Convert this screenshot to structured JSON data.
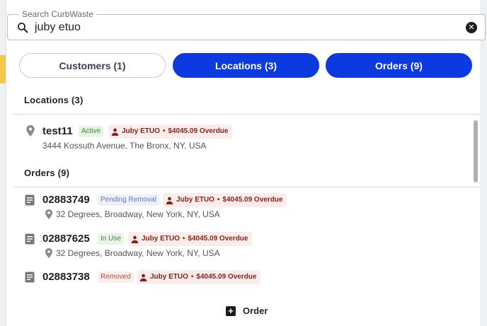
{
  "search": {
    "legend": "Search CurbWaste",
    "value": "juby etuo",
    "placeholder": "Search CurbWaste"
  },
  "tabs": [
    {
      "label": "Customers (1)"
    },
    {
      "label": "Locations (3)"
    },
    {
      "label": "Orders (9)"
    }
  ],
  "locations": {
    "title": "Locations (3)",
    "items": [
      {
        "name": "test11",
        "status": "Active",
        "owner": "Juby ETUO",
        "balance": "$4045.09 Overdue",
        "address": "3444 Kossuth Avenue, The Bronx, NY, USA"
      }
    ]
  },
  "orders": {
    "title": "Orders (9)",
    "items": [
      {
        "number": "02883749",
        "status": "Pending Removal",
        "owner": "Juby ETUO",
        "balance": "$4045.09 Overdue",
        "address": "32 Degrees, Broadway, New York, NY, USA"
      },
      {
        "number": "02887625",
        "status": "In Use",
        "owner": "Juby ETUO",
        "balance": "$4045.09 Overdue",
        "address": "32 Degrees, Broadway, New York, NY, USA"
      },
      {
        "number": "02883738",
        "status": "Removed",
        "owner": "Juby ETUO",
        "balance": "$4045.09 Overdue",
        "address": ""
      }
    ]
  },
  "footer": {
    "order_label": "Order"
  },
  "colors": {
    "accent": "#0b3be0",
    "overdue_chip": "#fdecec"
  }
}
